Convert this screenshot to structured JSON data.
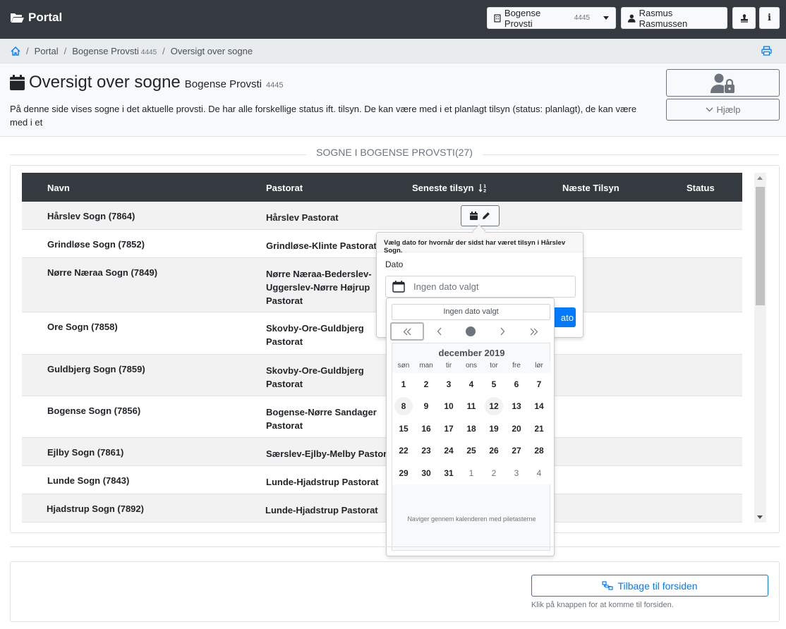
{
  "navbar": {
    "brand": "Portal",
    "org_name": "Bogense Provsti",
    "org_code": "4445",
    "user_name": "Rasmus Rasmussen",
    "info_label": "i"
  },
  "breadcrumb": {
    "portal": "Portal",
    "org_name": "Bogense Provsti",
    "org_code": "4445",
    "current": "Oversigt over sogne"
  },
  "header": {
    "title": "Oversigt over sogne",
    "subtitle": "Bogense Provsti",
    "code": "4445",
    "description": "På denne side vises sogne i det aktuelle provsti. De har alle forskellige status ift. tilsyn. De kan være med i et planlagt tilsyn (status: planlagt), de kan være med i et",
    "help_label": "Hjælp"
  },
  "section": {
    "title": "SOGNE I BOGENSE PROVSTI",
    "count": "(27)"
  },
  "table": {
    "headers": {
      "name": "Navn",
      "pastorat": "Pastorat",
      "latest": "Seneste tilsyn",
      "next": "Næste Tilsyn",
      "status": "Status"
    },
    "rows": [
      {
        "name": "Hårslev Sogn (7864)",
        "pastorat": "Hårslev Pastorat"
      },
      {
        "name": "Grindløse Sogn (7852)",
        "pastorat": "Grindløse-Klinte Pastorat"
      },
      {
        "name": "Nørre Næraa Sogn (7849)",
        "pastorat": "Nørre Næraa-Bederslev-Uggerslev-Nørre Højrup Pastorat"
      },
      {
        "name": "Ore Sogn (7858)",
        "pastorat": "Skovby-Ore-Guldbjerg Pastorat"
      },
      {
        "name": "Guldbjerg Sogn (7859)",
        "pastorat": "Skovby-Ore-Guldbjerg Pastorat"
      },
      {
        "name": "Bogense Sogn (7856)",
        "pastorat": "Bogense-Nørre Sandager Pastorat"
      },
      {
        "name": "Ejlby Sogn (7861)",
        "pastorat": "Særslev-Ejlby-Melby Pastorat"
      },
      {
        "name": "Lunde Sogn (7843)",
        "pastorat": "Lunde-Hjadstrup Pastorat"
      },
      {
        "name": "Hjadstrup Sogn (7892)",
        "pastorat": "Lunde-Hjadstrup Pastorat"
      }
    ]
  },
  "popover": {
    "title": "Vælg dato for hvornår der sidst har været tilsyn i Hårslev Sogn.",
    "date_label": "Dato",
    "date_placeholder": "Ingen dato valgt",
    "save_label": "ato"
  },
  "calendar": {
    "value": "Ingen dato valgt",
    "month": "december 2019",
    "weekdays": [
      "søn",
      "man",
      "tir",
      "ons",
      "tor",
      "fre",
      "lør"
    ],
    "weeks": [
      [
        "1",
        "2",
        "3",
        "4",
        "5",
        "6",
        "7"
      ],
      [
        "8",
        "9",
        "10",
        "11",
        "12",
        "13",
        "14"
      ],
      [
        "15",
        "16",
        "17",
        "18",
        "19",
        "20",
        "21"
      ],
      [
        "22",
        "23",
        "24",
        "25",
        "26",
        "27",
        "28"
      ],
      [
        "29",
        "30",
        "31",
        "1",
        "2",
        "3",
        "4"
      ]
    ],
    "help": "Naviger gennem kalenderen med piletasterne"
  },
  "bottom": {
    "back_label": "Tilbage til forsiden",
    "back_help": "Klik på knappen for at komme til forsiden."
  },
  "colors": {
    "navbar": "#343a40",
    "primary": "#007bff",
    "muted": "#6c757d"
  }
}
